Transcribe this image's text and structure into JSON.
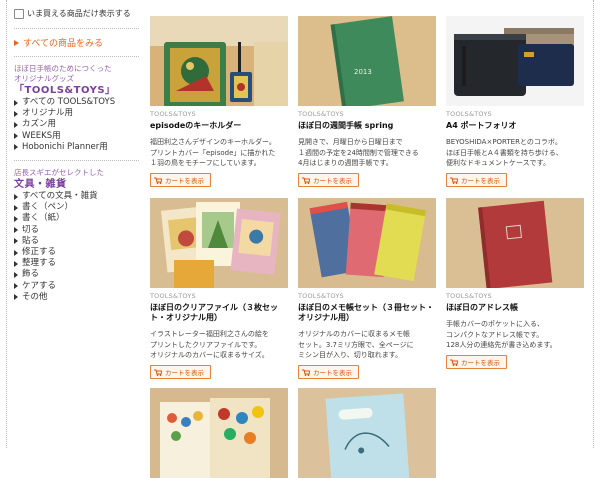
{
  "sidebar": {
    "stock_filter_label": "いま買える商品だけ表示する",
    "all_products_link": "すべての商品をみる",
    "section_tools": {
      "intro_line1": "ほぼ日手帳のためにつくった",
      "intro_line2": "オリジナルグッズ",
      "title": "「TOOLS&TOYS」",
      "items": [
        "すべての TOOLS&TOYS",
        "オリジナル用",
        "カズン用",
        "WEEKS用",
        "Hobonichi Planner用"
      ]
    },
    "section_stationery": {
      "intro_line1": "店長スギエがセレクトした",
      "title": "文具・雑貨",
      "items": [
        "すべての文具・雑貨",
        "書く（ペン）",
        "書く（紙）",
        "切る",
        "貼る",
        "修正する",
        "整理する",
        "飾る",
        "ケアする",
        "その他"
      ]
    }
  },
  "products": [
    {
      "category": "TOOLS&TOYS",
      "name": "episodeのキーホルダー",
      "desc": [
        "福田利之さんデザインのキーホルダー。",
        "プリントカバー「episode」に描かれた",
        "１羽の鳥をモチーフにしています。"
      ],
      "cart_label": "カートを表示"
    },
    {
      "category": "TOOLS&TOYS",
      "name": "ほぼ日の週間手帳 spring",
      "desc": [
        "見開きで、月曜日から日曜日まで",
        "１週間の予定を24時間制で管理できる",
        "4月はじまりの週間手帳です。"
      ],
      "cart_label": "カートを表示",
      "cover_year": "2013"
    },
    {
      "category": "TOOLS&TOYS",
      "name": "A4 ポートフォリオ",
      "desc": [
        "BEYOSHIDA×PORTERとのコラボ。",
        "ほぼ日手帳とA４書類を持ち歩ける、",
        "便利なドキュメントケースです。"
      ],
      "cart_label": "カートを表示"
    },
    {
      "category": "TOOLS&TOYS",
      "name": "ほぼ日のクリアファイル（３枚セット・オリジナル用）",
      "desc": [
        "イラストレーター福田利之さんの絵を",
        "プリントしたクリアファイルです。",
        "オリジナルのカバーに収まるサイズ。"
      ],
      "cart_label": "カートを表示"
    },
    {
      "category": "TOOLS&TOYS",
      "name": "ほぼ日のメモ帳セット（３冊セット・オリジナル用）",
      "desc": [
        "オリジナルのカバーに収まるメモ帳",
        "セット。3.7ミリ方眼で、全ページに",
        "ミシン目が入り、切り取れます。"
      ],
      "cart_label": "カートを表示"
    },
    {
      "category": "TOOLS&TOYS",
      "name": "ほぼ日のアドレス帳",
      "desc": [
        "手帳カバーのポケットに入る、",
        "コンパクトなアドレス帳です。",
        "128人分の連絡先が書き込めます。"
      ],
      "cart_label": "カートを表示"
    }
  ]
}
